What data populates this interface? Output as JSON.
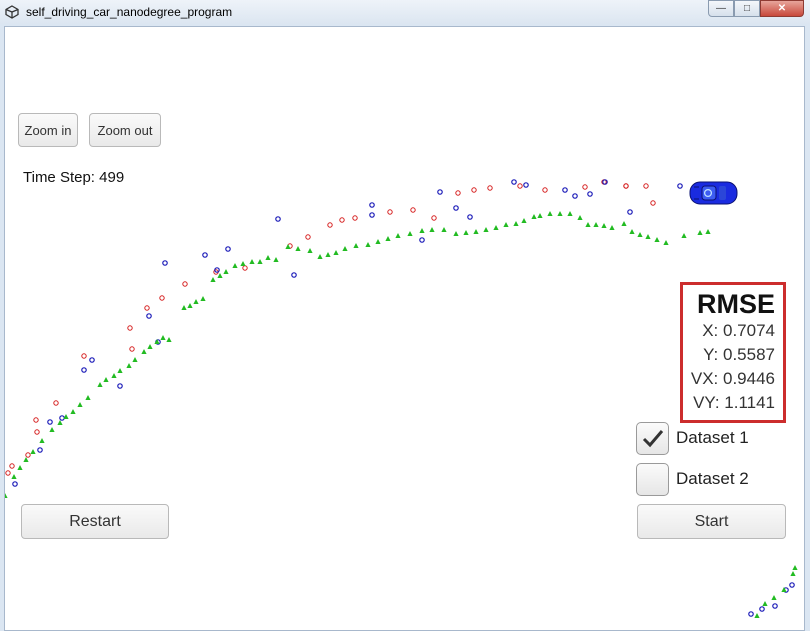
{
  "window": {
    "title": "self_driving_car_nanodegree_program"
  },
  "toolbar": {
    "zoom_in": "Zoom in",
    "zoom_out": "Zoom out"
  },
  "status": {
    "time_step": "Time Step: 499"
  },
  "rmse": {
    "title": "RMSE",
    "x": "X: 0.7074",
    "y": "Y: 0.5587",
    "vx": "VX: 0.9446",
    "vy": "VY: 1.1141"
  },
  "datasets": [
    {
      "label": "Dataset 1",
      "checked": true
    },
    {
      "label": "Dataset 2",
      "checked": false
    }
  ],
  "controls": {
    "restart": "Restart",
    "start": "Start"
  },
  "colors": {
    "lidar": "#d62020",
    "radar": "#1a1ab8",
    "estimate": "#22bb22",
    "car": "#1a2be0",
    "rmse_border": "#cc2d2d"
  }
}
